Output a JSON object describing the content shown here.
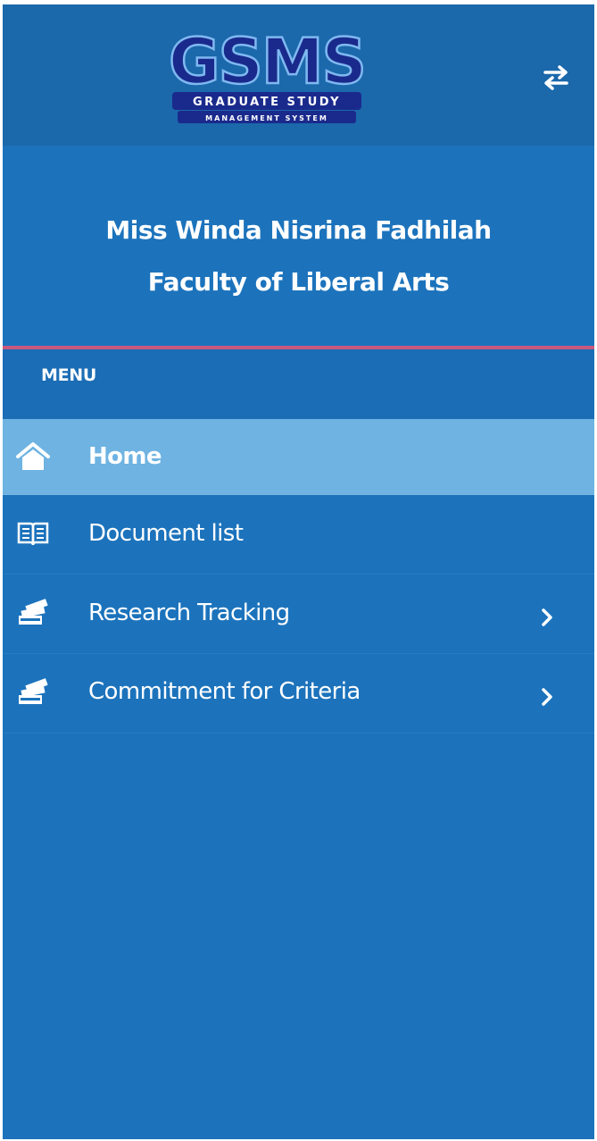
{
  "brand": {
    "logo_text": "GSMS",
    "tagline_line1": "GRADUATE STUDY",
    "tagline_line2": "MANAGEMENT SYSTEM"
  },
  "header": {
    "toggle_icon": "swap-arrows-icon"
  },
  "profile": {
    "name": "Miss Winda Nisrina Fadhilah",
    "faculty": "Faculty of Liberal Arts"
  },
  "menu": {
    "heading": "MENU",
    "items": [
      {
        "label": "Home",
        "icon": "home-icon",
        "active": true,
        "has_submenu": false
      },
      {
        "label": "Document list",
        "icon": "book-icon",
        "active": false,
        "has_submenu": false
      },
      {
        "label": "Research Tracking",
        "icon": "money-stack-icon",
        "active": false,
        "has_submenu": true
      },
      {
        "label": "Commitment for Criteria",
        "icon": "money-stack-icon",
        "active": false,
        "has_submenu": true
      }
    ]
  },
  "colors": {
    "sidebar_bg": "#1c73bc",
    "header_bg": "#1b68ab",
    "active_item_bg": "#6eb3e2",
    "divider": "#c9587e",
    "logo_navy": "#1a2a8c"
  }
}
